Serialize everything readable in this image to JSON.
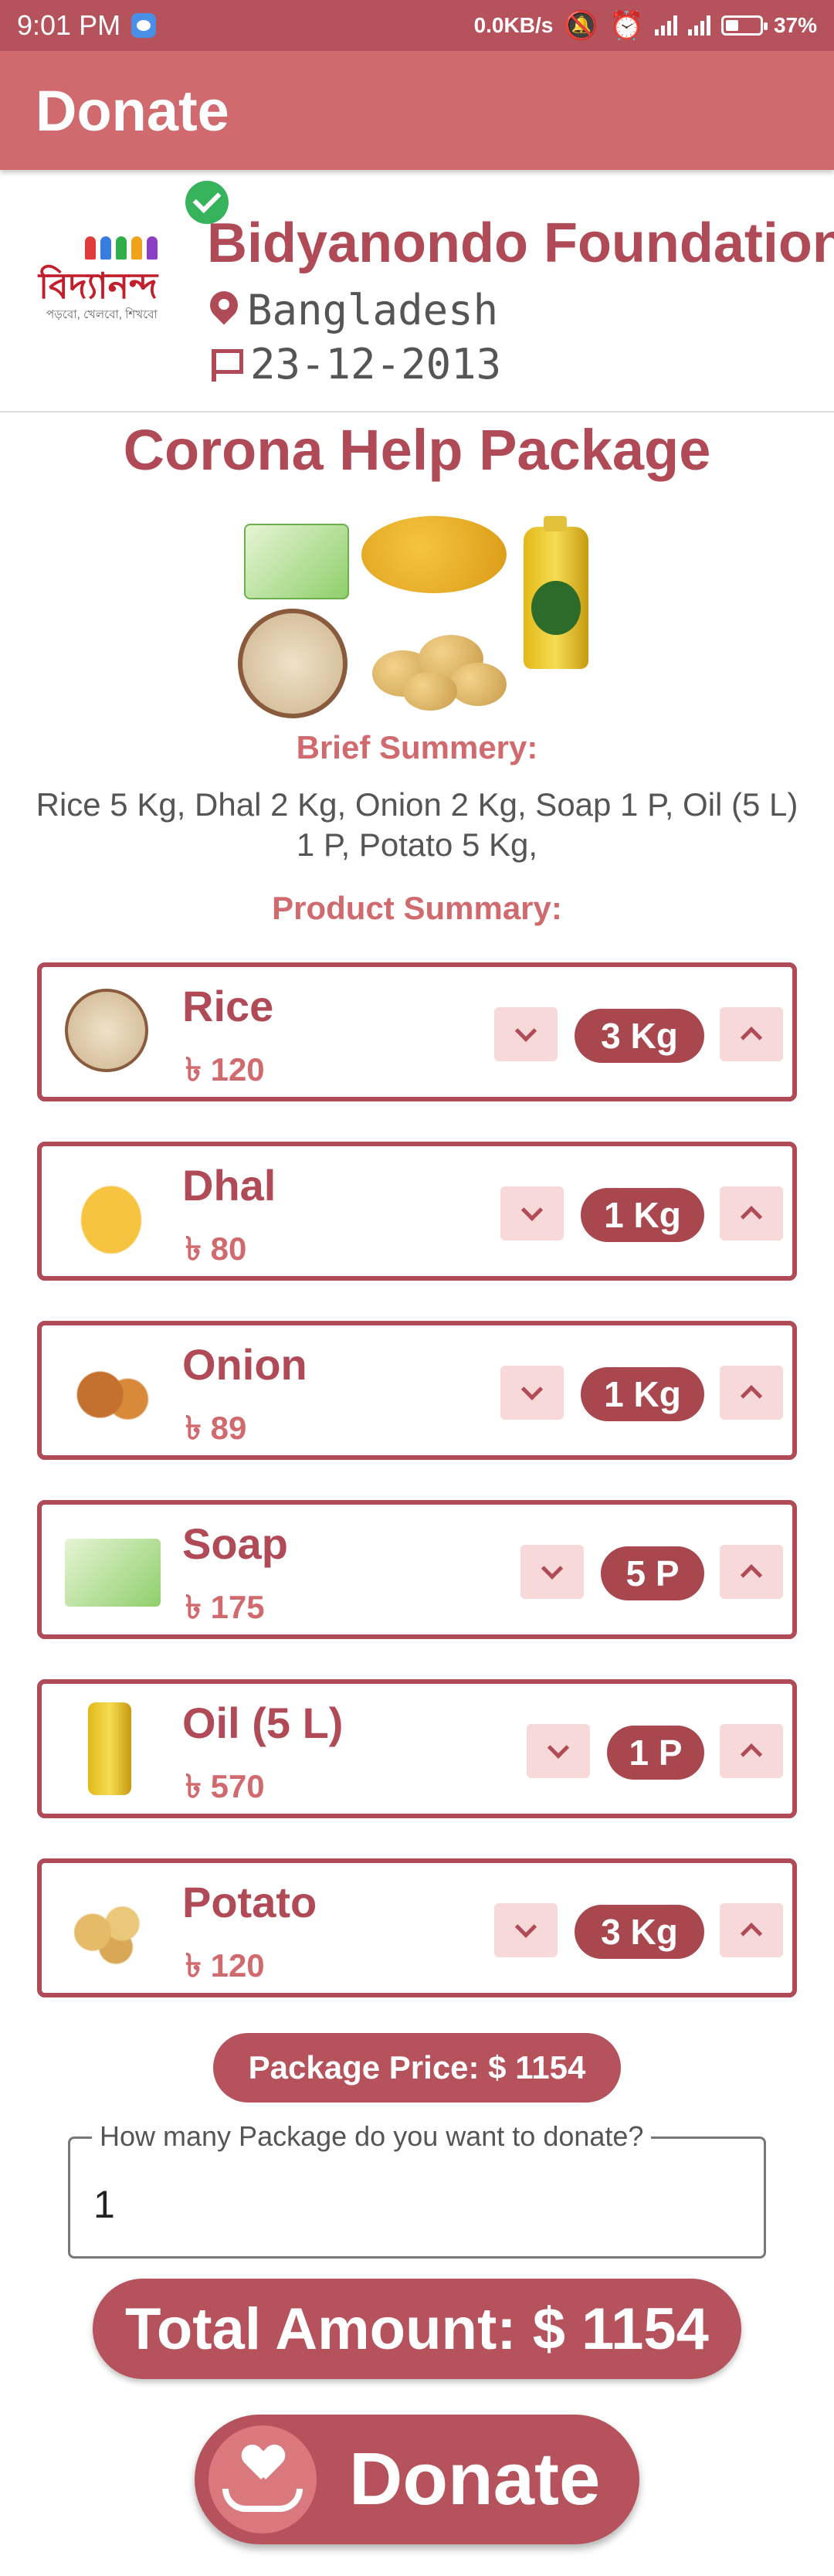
{
  "status_bar": {
    "time": "9:01 PM",
    "net_speed": "0.0KB/s",
    "battery": "37%"
  },
  "app_bar": {
    "title": "Donate"
  },
  "organization": {
    "name": "Bidyanondo Foundation",
    "logo_text": "বিদ্যানন্দ",
    "logo_tagline": "পড়বো, খেলবো, শিখবো",
    "location": "Bangladesh",
    "date": "23-12-2013",
    "verified_icon": "check-circle-icon"
  },
  "package": {
    "title": "Corona Help Package",
    "brief_label": "Brief Summery:",
    "brief_text": "Rice 5 Kg, Dhal 2 Kg, Onion 2 Kg, Soap 1 P, Oil (5 L) 1 P, Potato 5 Kg,",
    "product_label": "Product Summary:"
  },
  "products": [
    {
      "name": "Rice",
      "price": "৳ 120",
      "qty": "3 Kg"
    },
    {
      "name": "Dhal",
      "price": "৳ 80",
      "qty": "1 Kg"
    },
    {
      "name": "Onion",
      "price": "৳ 89",
      "qty": "1 Kg"
    },
    {
      "name": "Soap",
      "price": "৳ 175",
      "qty": "5 P"
    },
    {
      "name": "Oil (5 L)",
      "price": "৳ 570",
      "qty": "1 P"
    },
    {
      "name": "Potato",
      "price": "৳ 120",
      "qty": "3 Kg"
    }
  ],
  "summary": {
    "package_price": "Package Price: $ 1154",
    "quantity_label": "How many Package do you want to donate?",
    "quantity_value": "1",
    "total_amount": "Total Amount: $ 1154",
    "donate_label": "Donate"
  },
  "colors": {
    "primary": "#b5525c",
    "app_bar": "#d06a6e",
    "stepper_bg": "#f7d9d9"
  }
}
